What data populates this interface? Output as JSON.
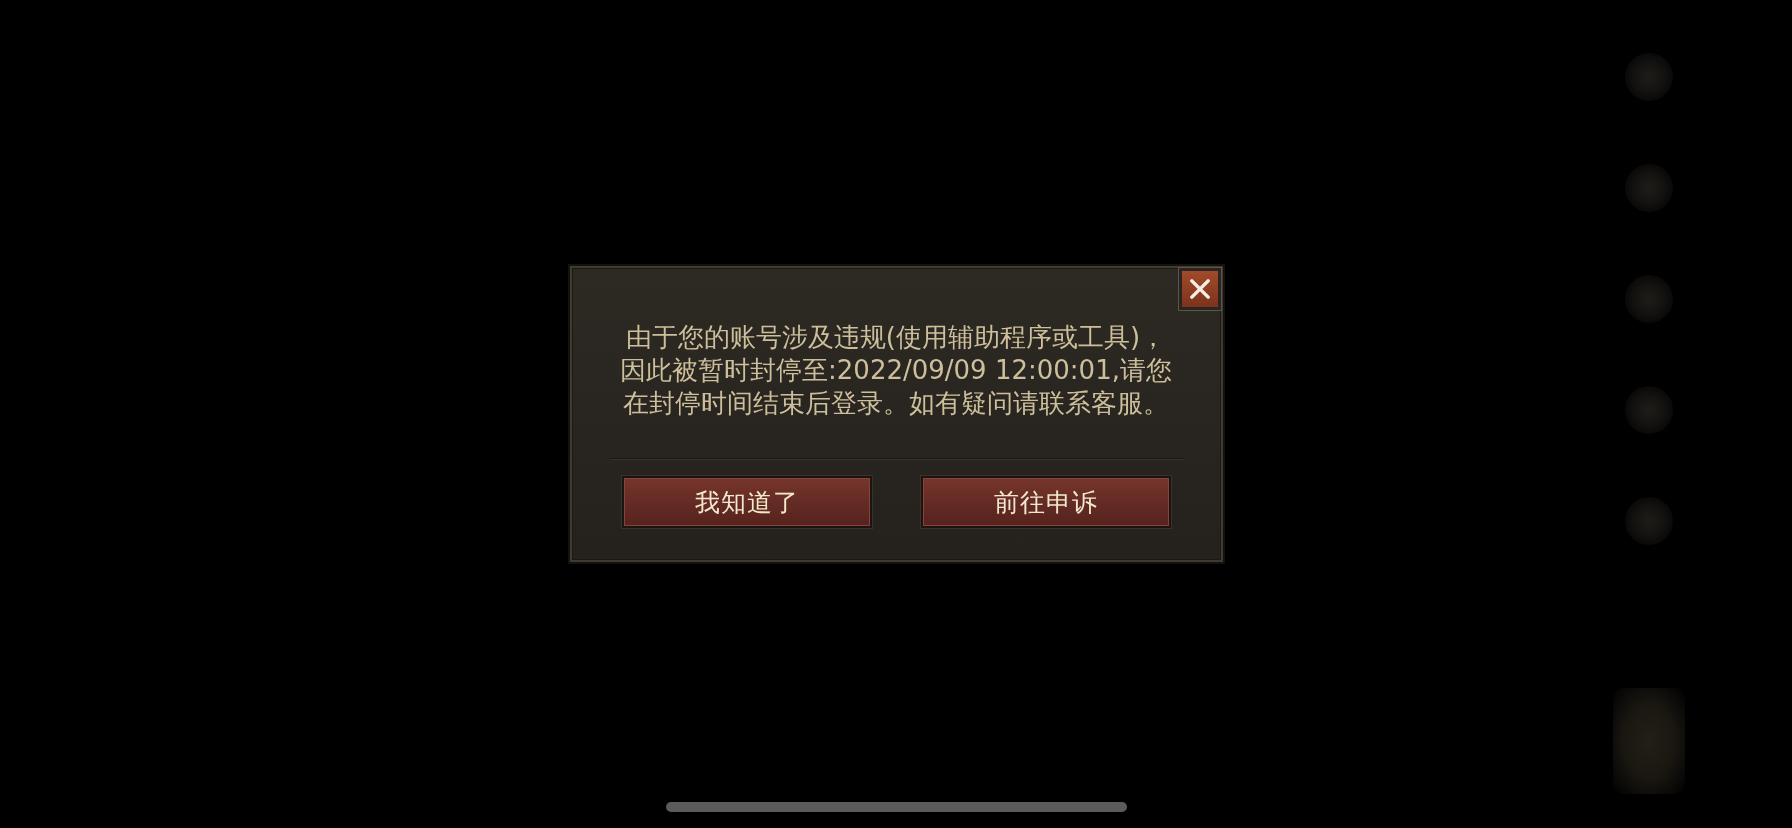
{
  "dialog": {
    "message": "由于您的账号涉及违规(使用辅助程序或工具)，因此被暂时封停至:2022/09/09 12:00:01,请您在封停时间结束后登录。如有疑问请联系客服。",
    "buttons": [
      {
        "label": "我知道了"
      },
      {
        "label": "前往申诉"
      }
    ]
  }
}
